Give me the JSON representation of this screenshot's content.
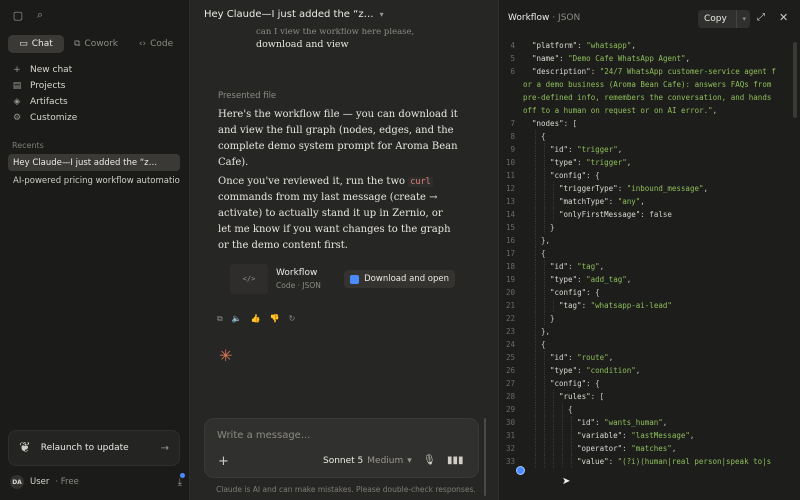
{
  "sidebar": {
    "mode_tabs": [
      {
        "label": "Chat",
        "icon": "chat-icon",
        "active": true
      },
      {
        "label": "Cowork",
        "icon": "cowork-icon",
        "active": false
      },
      {
        "label": "Code",
        "icon": "code-icon",
        "active": false
      }
    ],
    "nav": [
      {
        "label": "New chat",
        "icon": "plus-icon"
      },
      {
        "label": "Projects",
        "icon": "folder-icon"
      },
      {
        "label": "Artifacts",
        "icon": "artifacts-icon"
      },
      {
        "label": "Customize",
        "icon": "customize-icon"
      }
    ],
    "recents_label": "Recents",
    "recents": [
      {
        "label": "Hey Claude—I just added the “z…",
        "active": true
      },
      {
        "label": "AI-powered pricing workflow automation",
        "active": false
      }
    ],
    "relaunch_label": "Relaunch to update",
    "user": {
      "initials": "DA",
      "name": "User",
      "plan": "Free"
    }
  },
  "chat": {
    "title": "Hey Claude—I just added the “z…",
    "user_message_cut": "can I view the workflow here please,",
    "user_message": "download and view",
    "presented_label": "Presented file",
    "para1": "Here's the workflow file — you can download it and view the full graph (nodes, edges, and the complete demo system prompt for Aroma Bean Cafe).",
    "para2_a": "Once you've reviewed it, run the two ",
    "para2_code": "curl",
    "para2_b": " commands from my last message (create → activate) to actually stand it up in Zernio, or let me know if you want changes to the graph or the demo content first.",
    "file": {
      "name": "Workflow",
      "type": "Code · JSON",
      "thumb": "</>",
      "button": "Download and open"
    },
    "composer": {
      "placeholder": "Write a message...",
      "model": "Sonnet 5",
      "effort": "Medium"
    },
    "disclaimer": "Claude is AI and can make mistakes. Please double-check responses."
  },
  "panel": {
    "title": "Workflow",
    "filetype": "· JSON",
    "copy_label": "Copy",
    "code_lines": [
      {
        "n": "4",
        "indent": 1,
        "t": [
          [
            "k",
            "\"platform\""
          ],
          [
            "p",
            ": "
          ],
          [
            "s",
            "\"whatsapp\""
          ],
          [
            "p",
            ","
          ]
        ]
      },
      {
        "n": "5",
        "indent": 1,
        "t": [
          [
            "k",
            "\"name\""
          ],
          [
            "p",
            ": "
          ],
          [
            "s",
            "\"Demo Cafe WhatsApp Agent\""
          ],
          [
            "p",
            ","
          ]
        ]
      },
      {
        "n": "6",
        "indent": 1,
        "t": [
          [
            "k",
            "\"description\""
          ],
          [
            "p",
            ": "
          ],
          [
            "s",
            "\"24/7 WhatsApp customer-service agent f"
          ]
        ]
      },
      {
        "n": "",
        "indent": 0,
        "t": [
          [
            "s",
            "or a demo business (Aroma Bean Cafe): answers FAQs from"
          ]
        ]
      },
      {
        "n": "",
        "indent": 0,
        "t": [
          [
            "s",
            "pre-defined info, remembers the conversation, and hands"
          ]
        ]
      },
      {
        "n": "",
        "indent": 0,
        "t": [
          [
            "s",
            "off to a human on request or on AI error.\""
          ],
          [
            "p",
            ","
          ]
        ]
      },
      {
        "n": "7",
        "indent": 1,
        "t": [
          [
            "k",
            "\"nodes\""
          ],
          [
            "p",
            ": ["
          ]
        ]
      },
      {
        "n": "8",
        "indent": 2,
        "t": [
          [
            "p",
            "{"
          ]
        ]
      },
      {
        "n": "9",
        "indent": 3,
        "t": [
          [
            "k",
            "\"id\""
          ],
          [
            "p",
            ": "
          ],
          [
            "s",
            "\"trigger\""
          ],
          [
            "p",
            ","
          ]
        ]
      },
      {
        "n": "10",
        "indent": 3,
        "t": [
          [
            "k",
            "\"type\""
          ],
          [
            "p",
            ": "
          ],
          [
            "s",
            "\"trigger\""
          ],
          [
            "p",
            ","
          ]
        ]
      },
      {
        "n": "11",
        "indent": 3,
        "t": [
          [
            "k",
            "\"config\""
          ],
          [
            "p",
            ": {"
          ]
        ]
      },
      {
        "n": "12",
        "indent": 4,
        "t": [
          [
            "k",
            "\"triggerType\""
          ],
          [
            "p",
            ": "
          ],
          [
            "s",
            "\"inbound_message\""
          ],
          [
            "p",
            ","
          ]
        ]
      },
      {
        "n": "13",
        "indent": 4,
        "t": [
          [
            "k",
            "\"matchType\""
          ],
          [
            "p",
            ": "
          ],
          [
            "s",
            "\"any\""
          ],
          [
            "p",
            ","
          ]
        ]
      },
      {
        "n": "14",
        "indent": 4,
        "t": [
          [
            "k",
            "\"onlyFirstMessage\""
          ],
          [
            "p",
            ": false"
          ]
        ]
      },
      {
        "n": "15",
        "indent": 3,
        "t": [
          [
            "p",
            "}"
          ]
        ]
      },
      {
        "n": "16",
        "indent": 2,
        "t": [
          [
            "p",
            "},"
          ]
        ]
      },
      {
        "n": "17",
        "indent": 2,
        "t": [
          [
            "p",
            "{"
          ]
        ]
      },
      {
        "n": "18",
        "indent": 3,
        "t": [
          [
            "k",
            "\"id\""
          ],
          [
            "p",
            ": "
          ],
          [
            "s",
            "\"tag\""
          ],
          [
            "p",
            ","
          ]
        ]
      },
      {
        "n": "19",
        "indent": 3,
        "t": [
          [
            "k",
            "\"type\""
          ],
          [
            "p",
            ": "
          ],
          [
            "s",
            "\"add_tag\""
          ],
          [
            "p",
            ","
          ]
        ]
      },
      {
        "n": "20",
        "indent": 3,
        "t": [
          [
            "k",
            "\"config\""
          ],
          [
            "p",
            ": {"
          ]
        ]
      },
      {
        "n": "21",
        "indent": 4,
        "t": [
          [
            "k",
            "\"tag\""
          ],
          [
            "p",
            ": "
          ],
          [
            "s",
            "\"whatsapp-ai-lead\""
          ]
        ]
      },
      {
        "n": "22",
        "indent": 3,
        "t": [
          [
            "p",
            "}"
          ]
        ]
      },
      {
        "n": "23",
        "indent": 2,
        "t": [
          [
            "p",
            "},"
          ]
        ]
      },
      {
        "n": "24",
        "indent": 2,
        "t": [
          [
            "p",
            "{"
          ]
        ]
      },
      {
        "n": "25",
        "indent": 3,
        "t": [
          [
            "k",
            "\"id\""
          ],
          [
            "p",
            ": "
          ],
          [
            "s",
            "\"route\""
          ],
          [
            "p",
            ","
          ]
        ]
      },
      {
        "n": "26",
        "indent": 3,
        "t": [
          [
            "k",
            "\"type\""
          ],
          [
            "p",
            ": "
          ],
          [
            "s",
            "\"condition\""
          ],
          [
            "p",
            ","
          ]
        ]
      },
      {
        "n": "27",
        "indent": 3,
        "t": [
          [
            "k",
            "\"config\""
          ],
          [
            "p",
            ": {"
          ]
        ]
      },
      {
        "n": "28",
        "indent": 4,
        "t": [
          [
            "k",
            "\"rules\""
          ],
          [
            "p",
            ": ["
          ]
        ]
      },
      {
        "n": "29",
        "indent": 5,
        "t": [
          [
            "p",
            "{"
          ]
        ]
      },
      {
        "n": "30",
        "indent": 6,
        "t": [
          [
            "k",
            "\"id\""
          ],
          [
            "p",
            ": "
          ],
          [
            "s",
            "\"wants_human\""
          ],
          [
            "p",
            ","
          ]
        ]
      },
      {
        "n": "31",
        "indent": 6,
        "t": [
          [
            "k",
            "\"variable\""
          ],
          [
            "p",
            ": "
          ],
          [
            "s",
            "\"lastMessage\""
          ],
          [
            "p",
            ","
          ]
        ]
      },
      {
        "n": "32",
        "indent": 6,
        "t": [
          [
            "k",
            "\"operator\""
          ],
          [
            "p",
            ": "
          ],
          [
            "s",
            "\"matches\""
          ],
          [
            "p",
            ","
          ]
        ]
      },
      {
        "n": "33",
        "indent": 6,
        "t": [
          [
            "k",
            "\"value\""
          ],
          [
            "p",
            ": "
          ],
          [
            "s",
            "\"(?i)(human|real person|speak to|s"
          ]
        ]
      }
    ]
  }
}
